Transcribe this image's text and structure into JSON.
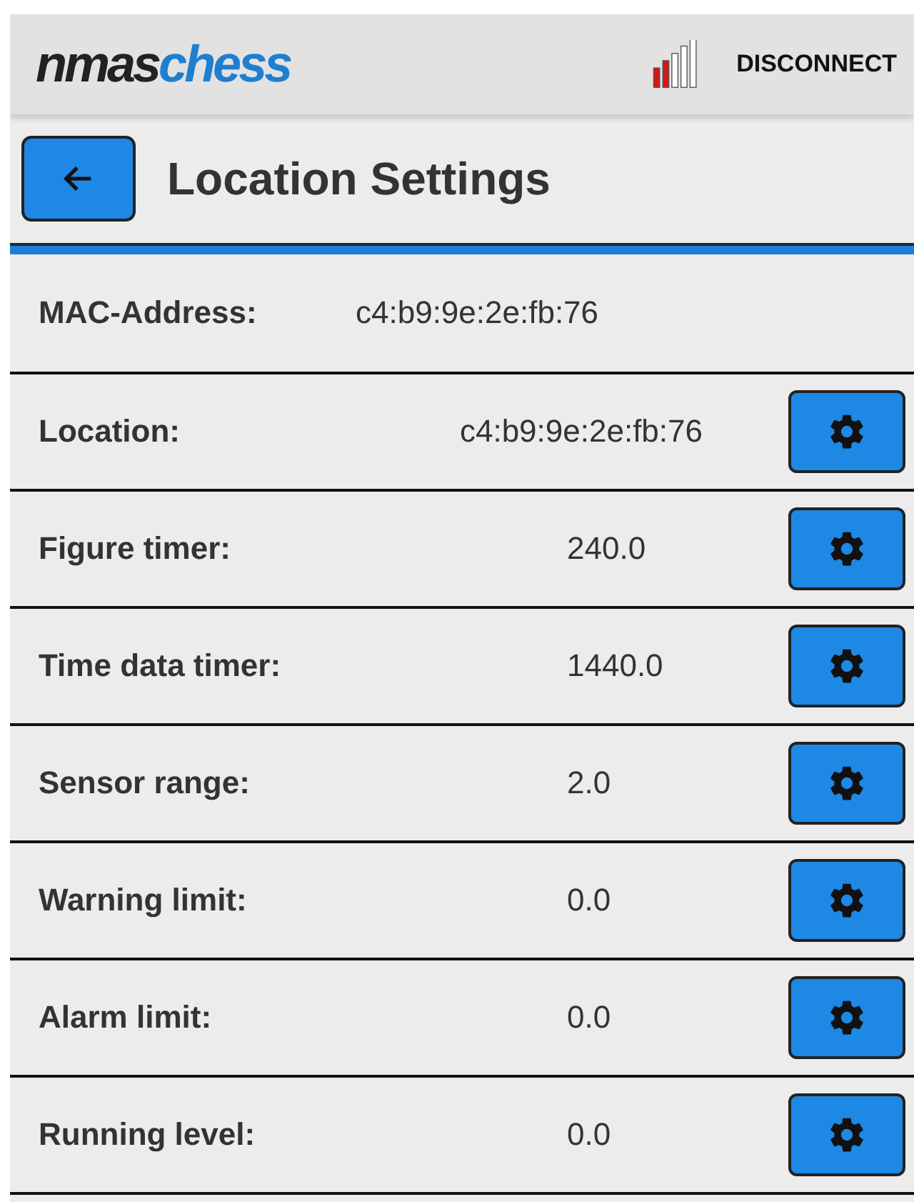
{
  "app_bar": {
    "logo": [
      "nmas",
      "chess"
    ],
    "action": "DISCONNECT"
  },
  "header": {
    "title": "Location Settings"
  },
  "mac": {
    "label": "MAC-Address:",
    "value": "c4:b9:9e:2e:fb:76"
  },
  "settings": [
    {
      "label": "Location:",
      "value": "c4:b9:9e:2e:fb:76"
    },
    {
      "label": "Figure timer:",
      "value": "240.0"
    },
    {
      "label": "Time data timer:",
      "value": "1440.0"
    },
    {
      "label": "Sensor range:",
      "value": "2.0"
    },
    {
      "label": "Warning limit:",
      "value": "0.0"
    },
    {
      "label": "Alarm limit:",
      "value": "0.0"
    },
    {
      "label": "Running level:",
      "value": "0.0"
    }
  ]
}
